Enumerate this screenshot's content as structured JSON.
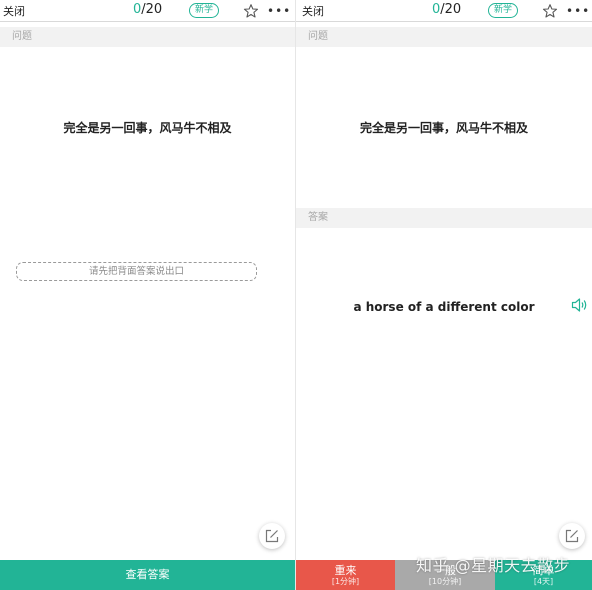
{
  "left": {
    "header": {
      "close_label": "关闭",
      "progress_current": "0",
      "progress_total": "/20",
      "badge": "新学"
    },
    "question_label": "问题",
    "question": "完全是另一回事，风马牛不相及",
    "hint": "请先把背面答案说出口",
    "show_answer_button": "查看答案"
  },
  "right": {
    "header": {
      "close_label": "关闭",
      "progress_current": "0",
      "progress_total": "/20",
      "badge": "新学"
    },
    "question_label": "问题",
    "question": "完全是另一回事，风马牛不相及",
    "answer_label": "答案",
    "answer": "a horse of a different color",
    "buttons": [
      {
        "label": "重来",
        "sub": "[1分钟]",
        "color": "#e8574a"
      },
      {
        "label": "一般",
        "sub": "[10分钟]",
        "color": "#a9a9a9"
      },
      {
        "label": "简单",
        "sub": "[4天]",
        "color": "#22b496"
      }
    ]
  },
  "watermark": "知乎 @星期天去散步",
  "accent_color": "#22b496",
  "icons": [
    "star-icon",
    "more-icon",
    "edit-icon",
    "speaker-icon"
  ]
}
